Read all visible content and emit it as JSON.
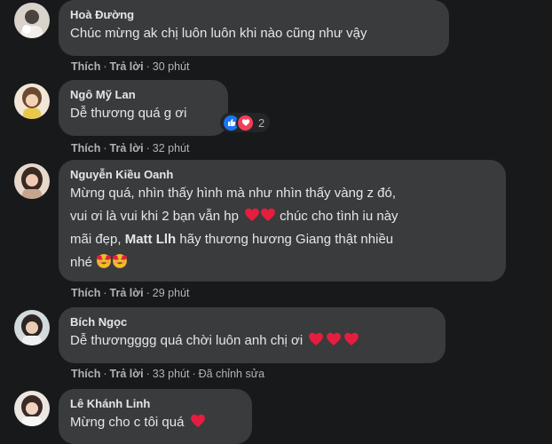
{
  "labels": {
    "like": "Thích",
    "reply": "Trả lời",
    "dot": "·"
  },
  "comments": [
    {
      "author": "Hoà Đường",
      "line1": "Chúc mừng ak chị luôn luôn khi nào cũng như vậy",
      "time": "30 phút"
    },
    {
      "author": "Ngô Mỹ Lan",
      "line1": "Dễ thương quá g ơi",
      "time": "32 phút",
      "reaction_count": "2"
    },
    {
      "author": "Nguyễn Kiều Oanh",
      "line1": "Mừng quá, nhìn thấy hình mà như nhìn thấy vàng z đó,",
      "line2": "vui ơi là vui khi 2 bạn vẫn hp",
      "line2b": "chúc cho tình iu này",
      "line3a": "mãi đẹp,",
      "mention": "Matt Llh",
      "line3b": "hãy thương hương Giang thật nhiều",
      "line4": "nhé",
      "time": "29 phút"
    },
    {
      "author": "Bích Ngọc",
      "line1": "Dễ thươngggg quá chời luôn anh chị ơi",
      "time": "33 phút",
      "edited": "Đã chỉnh sửa"
    },
    {
      "author": "Lê Khánh Linh",
      "line1": "Mừng cho c tôi quá"
    }
  ],
  "colors": {
    "background": "#18191a",
    "bubble": "#3a3b3c",
    "heart": "#e41e3f",
    "like_blue": "#1877f2"
  }
}
